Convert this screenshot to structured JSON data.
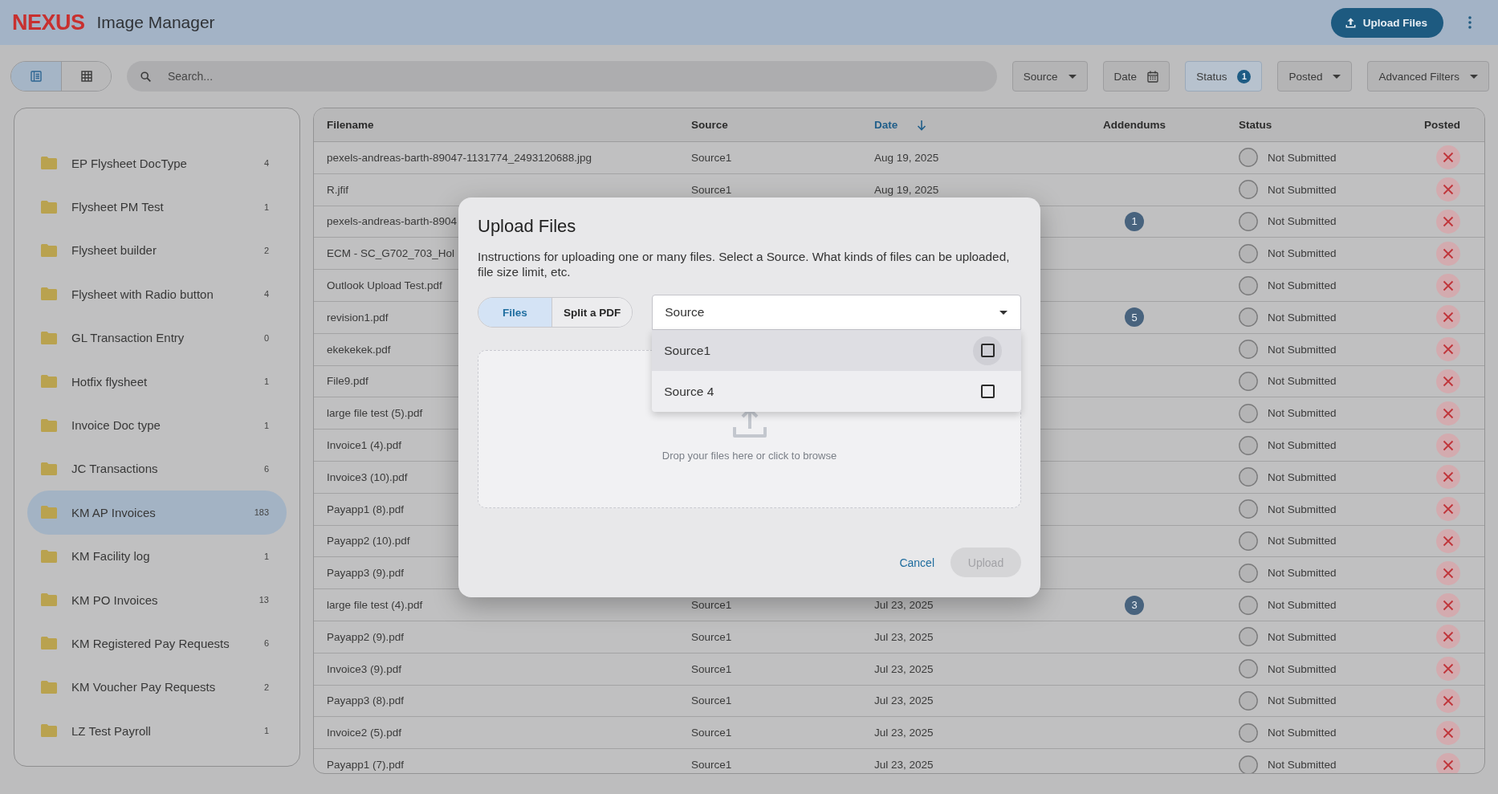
{
  "app_bar": {
    "logo": "NEXUS",
    "title": "Image Manager",
    "upload_button": "Upload Files"
  },
  "toolbar": {
    "view_modes": [
      {
        "selected": true
      },
      {
        "selected": false
      }
    ],
    "search": {
      "placeholder": "Search..."
    },
    "filters": [
      {
        "label": "Source",
        "kind": "dropdown",
        "active": false
      },
      {
        "label": "Date",
        "kind": "date",
        "active": false
      },
      {
        "label": "Status",
        "kind": "count",
        "count": "1",
        "active": true
      },
      {
        "label": "Posted",
        "kind": "dropdown",
        "active": false
      },
      {
        "label": "Advanced Filters",
        "kind": "dropdown",
        "active": false
      }
    ]
  },
  "sidebar": {
    "items": [
      {
        "label": "EP Flysheet DocType",
        "count": "4",
        "selected": false
      },
      {
        "label": "Flysheet PM Test",
        "count": "1",
        "selected": false
      },
      {
        "label": "Flysheet builder",
        "count": "2",
        "selected": false
      },
      {
        "label": "Flysheet with Radio button",
        "count": "4",
        "selected": false
      },
      {
        "label": "GL Transaction Entry",
        "count": "0",
        "selected": false
      },
      {
        "label": "Hotfix flysheet",
        "count": "1",
        "selected": false
      },
      {
        "label": "Invoice Doc type",
        "count": "1",
        "selected": false
      },
      {
        "label": "JC Transactions",
        "count": "6",
        "selected": false
      },
      {
        "label": "KM AP Invoices",
        "count": "183",
        "selected": true
      },
      {
        "label": "KM Facility log",
        "count": "1",
        "selected": false
      },
      {
        "label": "KM PO Invoices",
        "count": "13",
        "selected": false
      },
      {
        "label": "KM Registered Pay Requests",
        "count": "6",
        "selected": false
      },
      {
        "label": "KM Voucher Pay Requests",
        "count": "2",
        "selected": false
      },
      {
        "label": "LZ Test Payroll",
        "count": "1",
        "selected": false
      }
    ]
  },
  "table": {
    "columns": [
      {
        "label": "Filename",
        "sorted": false
      },
      {
        "label": "Source",
        "sorted": false
      },
      {
        "label": "Date",
        "sorted": true
      },
      {
        "label": "Addendums",
        "sorted": false
      },
      {
        "label": "Status",
        "sorted": false
      },
      {
        "label": "Posted",
        "sorted": false
      }
    ],
    "rows": [
      {
        "filename": "pexels-andreas-barth-89047-1131774_2493120688.jpg",
        "source": "Source1",
        "date": "Aug 19, 2025",
        "status": "Not Submitted",
        "posted": false
      },
      {
        "filename": "R.jfif",
        "source": "Source1",
        "date": "Aug 19, 2025",
        "status": "Not Submitted",
        "posted": false
      },
      {
        "filename": "pexels-andreas-barth-8904",
        "addendums": "1",
        "status": "Not Submitted",
        "posted": false
      },
      {
        "filename": "ECM - SC_G702_703_Hol",
        "status": "Not Submitted",
        "posted": false
      },
      {
        "filename": "Outlook Upload Test.pdf",
        "status": "Not Submitted",
        "posted": false
      },
      {
        "filename": "revision1.pdf",
        "addendums": "5",
        "status": "Not Submitted",
        "posted": false
      },
      {
        "filename": "ekekekek.pdf",
        "status": "Not Submitted",
        "posted": false
      },
      {
        "filename": "File9.pdf",
        "status": "Not Submitted",
        "posted": false
      },
      {
        "filename": "large file test (5).pdf",
        "status": "Not Submitted",
        "posted": false
      },
      {
        "filename": "Invoice1 (4).pdf",
        "status": "Not Submitted",
        "posted": false
      },
      {
        "filename": "Invoice3 (10).pdf",
        "status": "Not Submitted",
        "posted": false
      },
      {
        "filename": "Payapp1 (8).pdf",
        "status": "Not Submitted",
        "posted": false
      },
      {
        "filename": "Payapp2 (10).pdf",
        "status": "Not Submitted",
        "posted": false
      },
      {
        "filename": "Payapp3 (9).pdf",
        "status": "Not Submitted",
        "posted": false
      },
      {
        "filename": "large file test (4).pdf",
        "source": "Source1",
        "date": "Jul 23, 2025",
        "addendums": "3",
        "status": "Not Submitted",
        "posted": false
      },
      {
        "filename": "Payapp2 (9).pdf",
        "source": "Source1",
        "date": "Jul 23, 2025",
        "status": "Not Submitted",
        "posted": false
      },
      {
        "filename": "Invoice3 (9).pdf",
        "source": "Source1",
        "date": "Jul 23, 2025",
        "status": "Not Submitted",
        "posted": false
      },
      {
        "filename": "Payapp3 (8).pdf",
        "source": "Source1",
        "date": "Jul 23, 2025",
        "status": "Not Submitted",
        "posted": false
      },
      {
        "filename": "Invoice2 (5).pdf",
        "source": "Source1",
        "date": "Jul 23, 2025",
        "status": "Not Submitted",
        "posted": false
      },
      {
        "filename": "Payapp1 (7).pdf",
        "source": "Source1",
        "date": "Jul 23, 2025",
        "status": "Not Submitted",
        "posted": false
      }
    ]
  },
  "dialog": {
    "title": "Upload Files",
    "description": "Instructions for uploading one or many files. Select a Source. What kinds of files can be uploaded, file size limit, etc.",
    "modes": [
      {
        "label": "Files",
        "selected": true
      },
      {
        "label": "Split a PDF",
        "selected": false
      }
    ],
    "source_select": {
      "placeholder": "Source",
      "expanded": true,
      "options": [
        {
          "label": "Source1",
          "checked": false,
          "highlighted": true
        },
        {
          "label": "Source 4",
          "checked": false,
          "highlighted": false
        }
      ]
    },
    "dropzone": {
      "text": "Drop your files here or click to browse"
    },
    "buttons": [
      {
        "label": "Cancel",
        "kind": "text",
        "disabled": false
      },
      {
        "label": "Upload",
        "kind": "filled",
        "disabled": true
      }
    ]
  }
}
